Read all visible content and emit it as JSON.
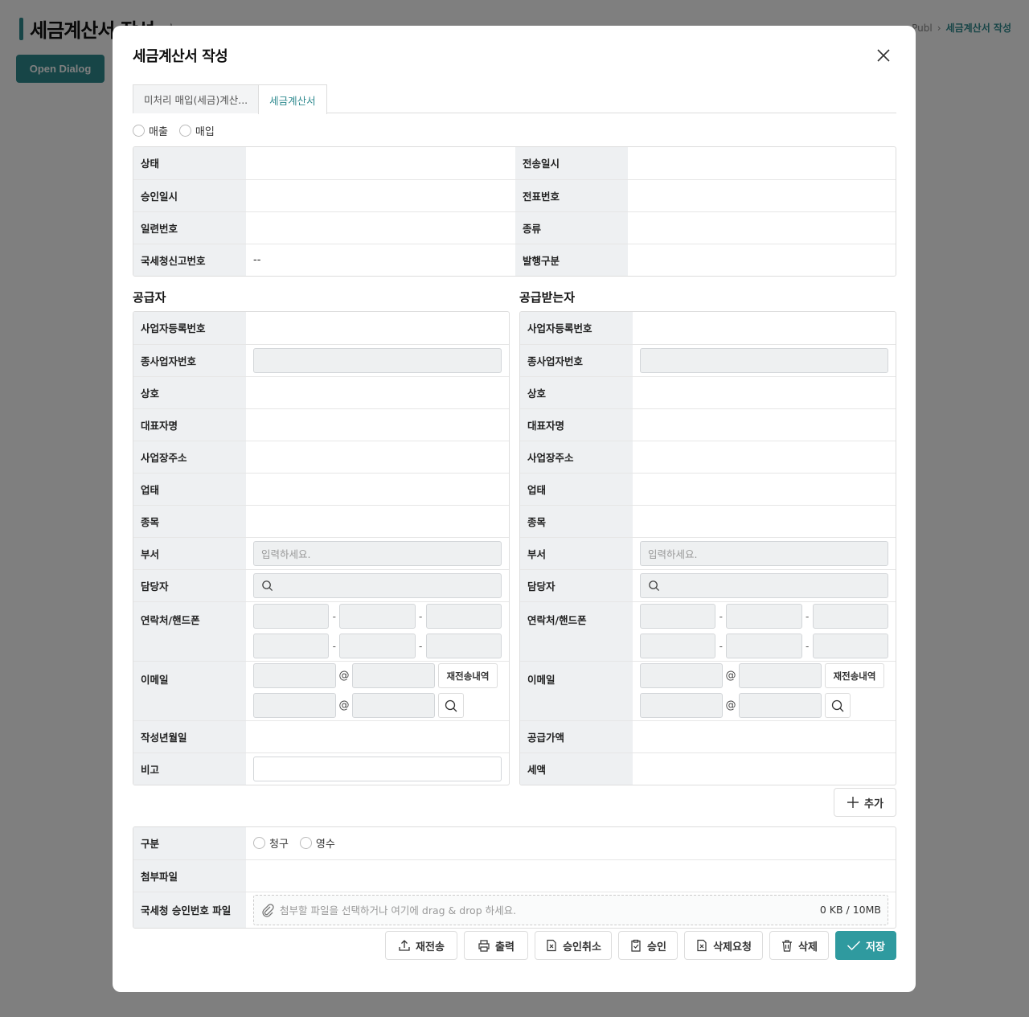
{
  "background": {
    "title": "세금계산서 작성",
    "star_icon": "star-outline-icon",
    "breadcrumb": [
      "Publ",
      "세금계산서 작성"
    ],
    "open_dialog_label": "Open Dialog"
  },
  "dialog": {
    "title": "세금계산서 작성",
    "tabs": [
      {
        "label": "미처리 매입(세금)계산...",
        "active": false
      },
      {
        "label": "세금계산서",
        "active": true
      }
    ],
    "type_radios": [
      "매출",
      "매입"
    ],
    "summary": {
      "rows": [
        {
          "left_label": "상태",
          "left_value": "",
          "right_label": "전송일시",
          "right_value": ""
        },
        {
          "left_label": "승인일시",
          "left_value": "",
          "right_label": "전표번호",
          "right_value": ""
        },
        {
          "left_label": "일련번호",
          "left_value": "",
          "right_label": "종류",
          "right_value": ""
        },
        {
          "left_label": "국세청신고번호",
          "left_value": "--",
          "right_label": "발행구분",
          "right_value": ""
        }
      ]
    },
    "supplier": {
      "heading": "공급자",
      "labels": {
        "biz_no": "사업자등록번호",
        "sub_biz_no": "종사업자번호",
        "company": "상호",
        "ceo": "대표자명",
        "address": "사업장주소",
        "biz_type": "업태",
        "biz_item": "종목",
        "dept": "부서",
        "manager": "담당자",
        "contact": "연락처/핸드폰",
        "email": "이메일",
        "date": "작성년월일",
        "note": "비고"
      },
      "dept_placeholder": "입력하세요.",
      "resend_history_label": "재전송내역"
    },
    "receiver": {
      "heading": "공급받는자",
      "labels": {
        "biz_no": "사업자등록번호",
        "sub_biz_no": "종사업자번호",
        "company": "상호",
        "ceo": "대표자명",
        "address": "사업장주소",
        "biz_type": "업태",
        "biz_item": "종목",
        "dept": "부서",
        "manager": "담당자",
        "contact": "연락처/핸드폰",
        "email": "이메일",
        "supply_amount": "공급가액",
        "tax": "세액"
      },
      "dept_placeholder": "입력하세요.",
      "resend_history_label": "재전송내역"
    },
    "add_label": "추가",
    "bottom": {
      "category_label": "구분",
      "category_radios": [
        "청구",
        "영수"
      ],
      "attachment_label": "첨부파일",
      "nts_file_label": "국세청 승인번호 파일",
      "dropzone_text": "첨부할 파일을 선택하거나 여기에 drag & drop 하세요.",
      "dropzone_size": "0 KB / 10MB"
    },
    "actions": [
      {
        "label": "재전송",
        "icon": "upload-icon"
      },
      {
        "label": "출력",
        "icon": "printer-icon"
      },
      {
        "label": "승인취소",
        "icon": "doc-x-icon"
      },
      {
        "label": "승인",
        "icon": "clipboard-check-icon"
      },
      {
        "label": "삭제요청",
        "icon": "doc-x-icon"
      },
      {
        "label": "삭제",
        "icon": "trash-icon"
      },
      {
        "label": "저장",
        "icon": "check-icon"
      }
    ],
    "colors": {
      "accent": "#2f9a9f",
      "label_bg": "#eef0f2"
    }
  }
}
